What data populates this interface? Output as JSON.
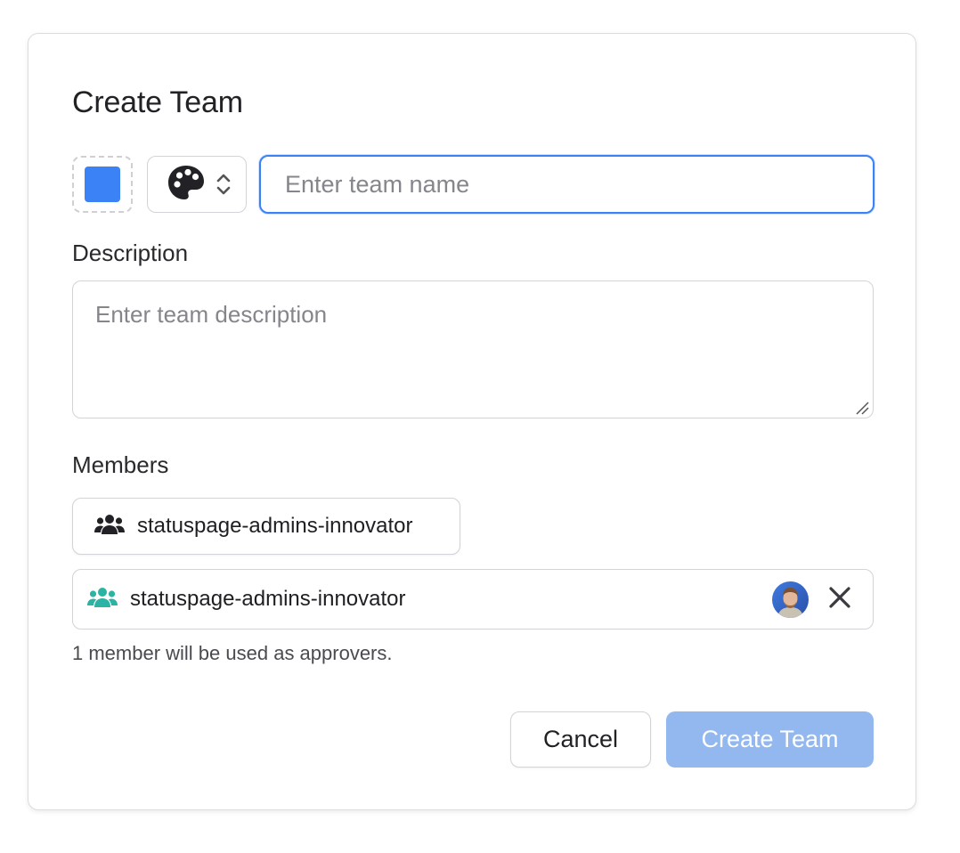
{
  "dialog": {
    "title": "Create Team"
  },
  "team_color": {
    "hex": "#3b82f6"
  },
  "icon_picker": {
    "icon": "palette-icon",
    "toggle_icon": "chevron-up-down-icon"
  },
  "name_field": {
    "value": "",
    "placeholder": "Enter team name"
  },
  "description": {
    "label": "Description",
    "value": "",
    "placeholder": "Enter team description"
  },
  "members": {
    "label": "Members",
    "group_option": {
      "icon": "users-icon",
      "label": "statuspage-admins-innovator"
    },
    "selected": [
      {
        "icon": "users-icon",
        "icon_color": "#2bb3a4",
        "label": "statuspage-admins-innovator",
        "avatar": "avatar",
        "remove_icon": "close-icon"
      }
    ],
    "helper_text": "1 member will be used as approvers."
  },
  "actions": {
    "cancel_label": "Cancel",
    "create_label": "Create Team",
    "create_color": "#93b8ef"
  }
}
